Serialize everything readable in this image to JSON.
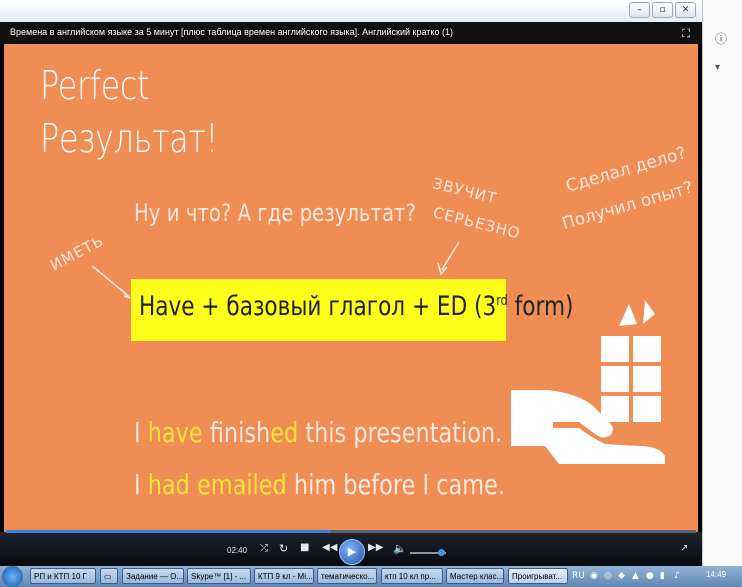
{
  "window": {
    "title": "Времена в английском языке за 5 минут [плюс таблица времен английского языка]. Английский кратко (1)",
    "fullscreen_icon": "fullscreen-icon"
  },
  "slide": {
    "heading1": "Perfect",
    "heading2": "Результат!",
    "question": "Ну и что? А где результат?",
    "note_imet": "ИМЕТЬ",
    "note_zvuchit1": "ЗВУЧИТ",
    "note_zvuchit2": "СЕРЬЕЗНО",
    "note_corner1": "Сделал дело?",
    "note_corner2": "Получил опыт?",
    "formula_main": "Have + базовый глагол + ED (3",
    "formula_sup": "rd",
    "formula_end": " form)",
    "example1": {
      "p1": "I ",
      "h1": "have",
      "p2": " finish",
      "h2": "ed",
      "p3": " this presentation."
    },
    "example2": {
      "p1": "I ",
      "h1": "had emailed",
      "p2": " him before I came."
    },
    "highlight_color": "#ffff1a",
    "background_color": "#ef8d55"
  },
  "controls": {
    "time": "02:40",
    "progress": 0.47,
    "volume": 0.85
  },
  "taskbar": {
    "items": [
      "РП и КТП 10 Г",
      "",
      "Задание — О...",
      "Skype™ [1] - ...",
      "КТП 9 кл - Mi...",
      "тематическо...",
      "ктп 10 кл пр...",
      "Мастер клас...",
      "Проигрыват..."
    ],
    "clock": "14:49"
  }
}
